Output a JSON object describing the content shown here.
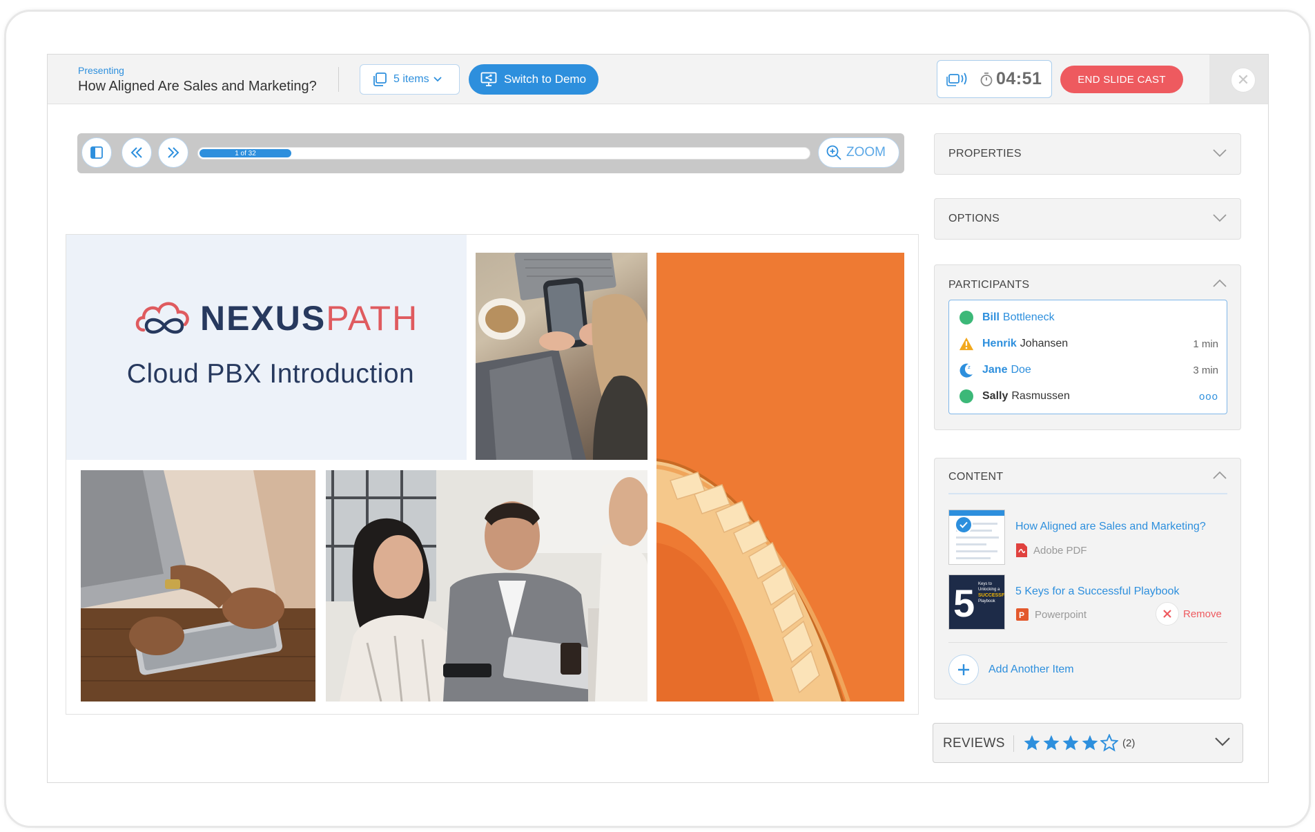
{
  "header": {
    "presenting_label": "Presenting",
    "title": "How Aligned Are Sales and Marketing?",
    "items_label": "5 items",
    "switch_label": "Switch to Demo",
    "timer": "04:51",
    "end_label": "END SLIDE CAST"
  },
  "toolbar": {
    "slide_position": "1 of 32",
    "progress_fraction": 0.15,
    "zoom_label": "ZOOM"
  },
  "slide": {
    "brand_nexus": "NEXUS",
    "brand_path": "PATH",
    "subtitle": "Cloud PBX Introduction",
    "colors": {
      "navy": "#27395e",
      "coral": "#df5b5f",
      "orange": "#ee7a33"
    }
  },
  "panels": {
    "properties_label": "PROPERTIES",
    "options_label": "OPTIONS",
    "participants_label": "PARTICIPANTS",
    "content_label": "CONTENT",
    "reviews_label": "REVIEWS"
  },
  "participants": [
    {
      "first": "Bill",
      "last": "Bottleneck",
      "status": "online",
      "time": ""
    },
    {
      "first": "Henrik",
      "last": "Johansen",
      "status": "warning",
      "time": "1 min"
    },
    {
      "first": "Jane",
      "last": "Doe",
      "status": "idle",
      "time": "3 min"
    },
    {
      "first": "Sally",
      "last": "Rasmussen",
      "status": "online",
      "more": "ooo"
    }
  ],
  "content": {
    "items": [
      {
        "title": "How Aligned are Sales and Marketing?",
        "type": "Adobe PDF"
      },
      {
        "title": "5 Keys for a Successful Playbook",
        "type": "Powerpoint",
        "thumb_number": "5",
        "thumb_caption": "Keys to Unlocking a Successful Playbook",
        "remove_label": "Remove"
      }
    ],
    "add_label": "Add Another Item"
  },
  "reviews": {
    "rating": 4,
    "max": 5,
    "count_label": "(2)"
  },
  "colors": {
    "accent": "#2d8fdd",
    "danger": "#ee5a5f",
    "online": "#3cb878",
    "warning": "#f2a81d"
  }
}
